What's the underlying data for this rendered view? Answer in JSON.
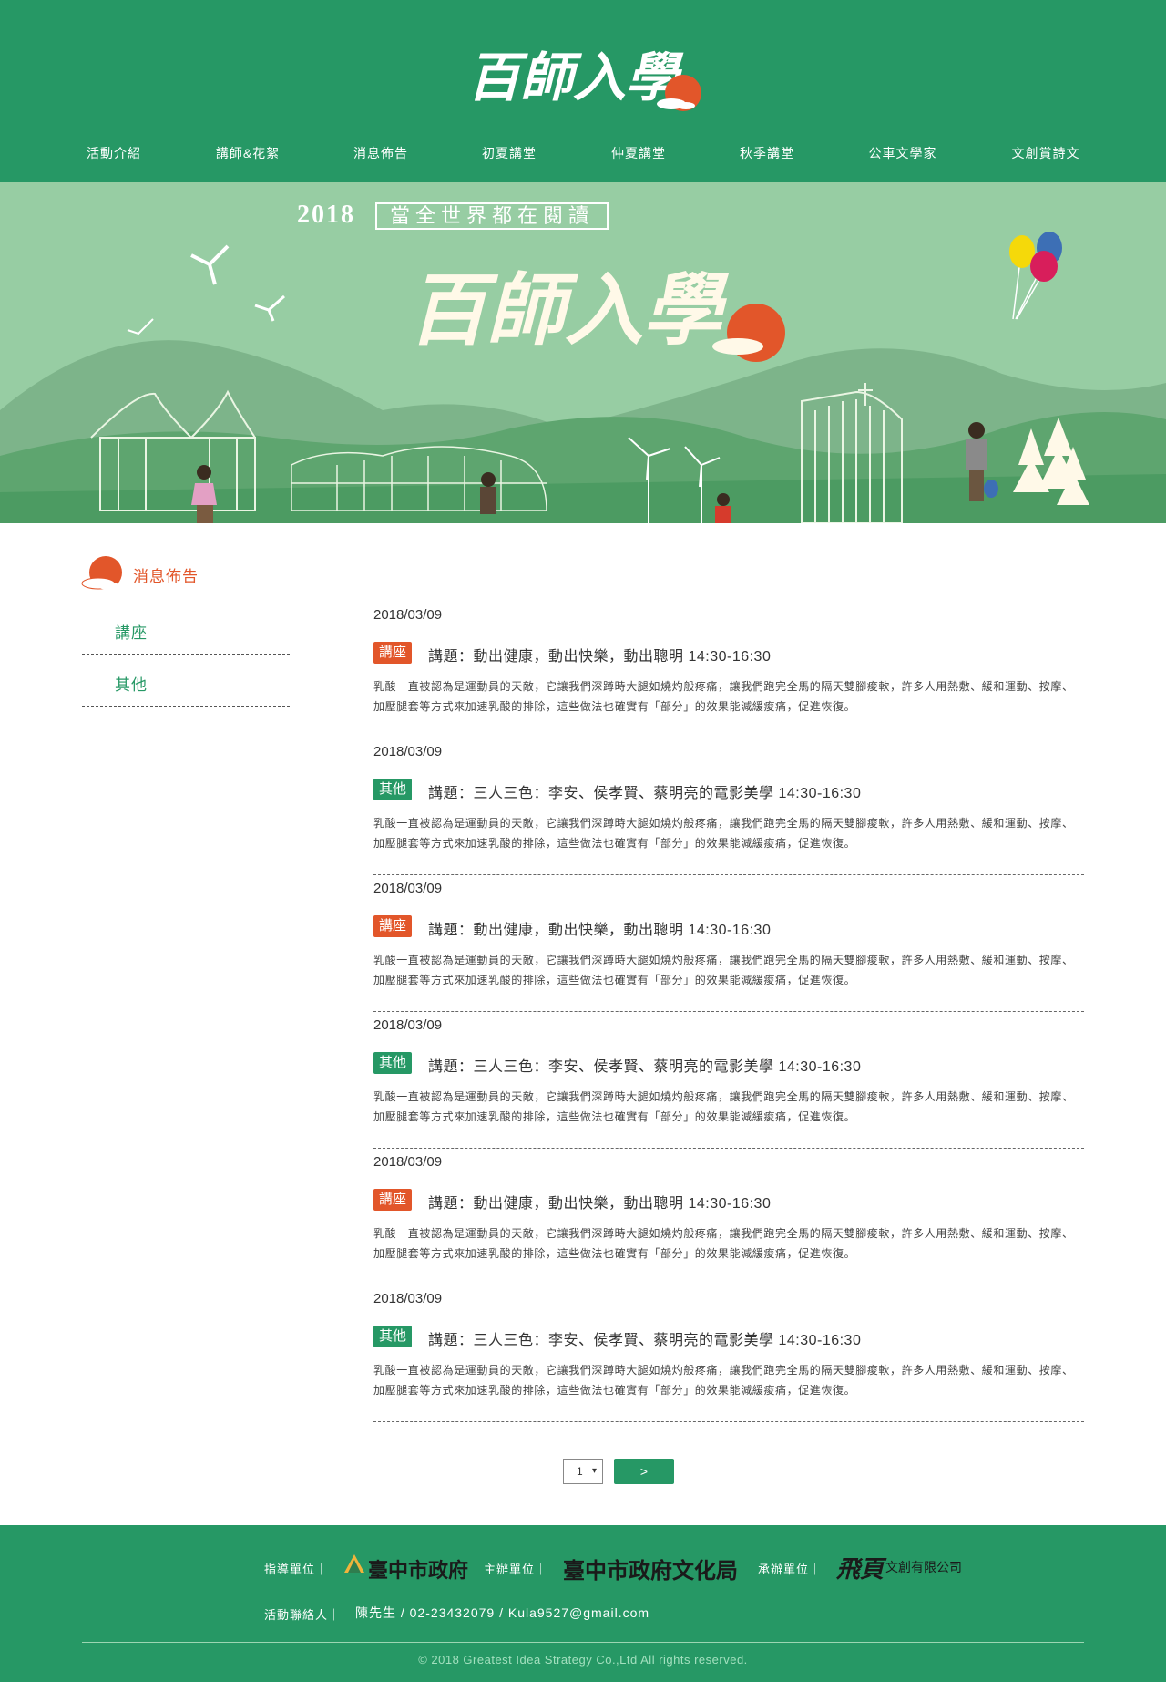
{
  "site": {
    "logo_text": "百師入學",
    "nav": [
      "活動介紹",
      "講師&花絮",
      "消息佈告",
      "初夏講堂",
      "仲夏講堂",
      "秋季講堂",
      "公車文學家",
      "文創賞詩文"
    ]
  },
  "banner": {
    "year": "2018",
    "tagline": "當全世界都在閱讀",
    "title": "百師入學"
  },
  "sidebar": {
    "title": "消息佈告",
    "items": [
      "講座",
      "其他"
    ]
  },
  "news": [
    {
      "date": "2018/03/09",
      "tag": "講座",
      "tag_color": "#e2562a",
      "title": "講題：動出健康，動出快樂，動出聰明 14:30-16:30",
      "body": "乳酸一直被認為是運動員的天敵，它讓我們深蹲時大腿如燒灼般疼痛，讓我們跑完全馬的隔天雙腳痠軟，許多人用熱敷、緩和運動、按摩、加壓腿套等方式來加速乳酸的排除，這些做法也確實有「部分」的效果能減緩痠痛，促進恢復。"
    },
    {
      "date": "2018/03/09",
      "tag": "其他",
      "tag_color": "#269865",
      "title": "講題：三人三色：李安、侯孝賢、蔡明亮的電影美學 14:30-16:30",
      "body": "乳酸一直被認為是運動員的天敵，它讓我們深蹲時大腿如燒灼般疼痛，讓我們跑完全馬的隔天雙腳痠軟，許多人用熱敷、緩和運動、按摩、加壓腿套等方式來加速乳酸的排除，這些做法也確實有「部分」的效果能減緩痠痛，促進恢復。"
    },
    {
      "date": "2018/03/09",
      "tag": "講座",
      "tag_color": "#e2562a",
      "title": "講題：動出健康，動出快樂，動出聰明 14:30-16:30",
      "body": "乳酸一直被認為是運動員的天敵，它讓我們深蹲時大腿如燒灼般疼痛，讓我們跑完全馬的隔天雙腳痠軟，許多人用熱敷、緩和運動、按摩、加壓腿套等方式來加速乳酸的排除，這些做法也確實有「部分」的效果能減緩痠痛，促進恢復。"
    },
    {
      "date": "2018/03/09",
      "tag": "其他",
      "tag_color": "#269865",
      "title": "講題：三人三色：李安、侯孝賢、蔡明亮的電影美學 14:30-16:30",
      "body": "乳酸一直被認為是運動員的天敵，它讓我們深蹲時大腿如燒灼般疼痛，讓我們跑完全馬的隔天雙腳痠軟，許多人用熱敷、緩和運動、按摩、加壓腿套等方式來加速乳酸的排除，這些做法也確實有「部分」的效果能減緩痠痛，促進恢復。"
    },
    {
      "date": "2018/03/09",
      "tag": "講座",
      "tag_color": "#e2562a",
      "title": "講題：動出健康，動出快樂，動出聰明 14:30-16:30",
      "body": "乳酸一直被認為是運動員的天敵，它讓我們深蹲時大腿如燒灼般疼痛，讓我們跑完全馬的隔天雙腳痠軟，許多人用熱敷、緩和運動、按摩、加壓腿套等方式來加速乳酸的排除，這些做法也確實有「部分」的效果能減緩痠痛，促進恢復。"
    },
    {
      "date": "2018/03/09",
      "tag": "其他",
      "tag_color": "#269865",
      "title": "講題：三人三色：李安、侯孝賢、蔡明亮的電影美學 14:30-16:30",
      "body": "乳酸一直被認為是運動員的天敵，它讓我們深蹲時大腿如燒灼般疼痛，讓我們跑完全馬的隔天雙腳痠軟，許多人用熱敷、緩和運動、按摩、加壓腿套等方式來加速乳酸的排除，這些做法也確實有「部分」的效果能減緩痠痛，促進恢復。"
    }
  ],
  "pagination": {
    "current_page": "1",
    "caret": "▾",
    "next_label": ">"
  },
  "footer": {
    "guide_label": "指導單位｜",
    "guide_name": "臺中市政府",
    "host_label": "主辦單位｜",
    "host_name": "臺中市政府文化局",
    "organizer_label": "承辦單位｜",
    "organizer_logo": "飛頁",
    "organizer_name": "文創有限公司",
    "contact_label": "活動聯絡人｜",
    "contact_value": "陳先生 / 02-23432079 / Kula9527@gmail.com",
    "copyright": "© 2018 Greatest Idea Strategy Co.,Ltd All rights reserved."
  },
  "colors": {
    "brand_green": "#269865",
    "accent_orange": "#e2562a",
    "banner_bg": "#97cda3"
  }
}
